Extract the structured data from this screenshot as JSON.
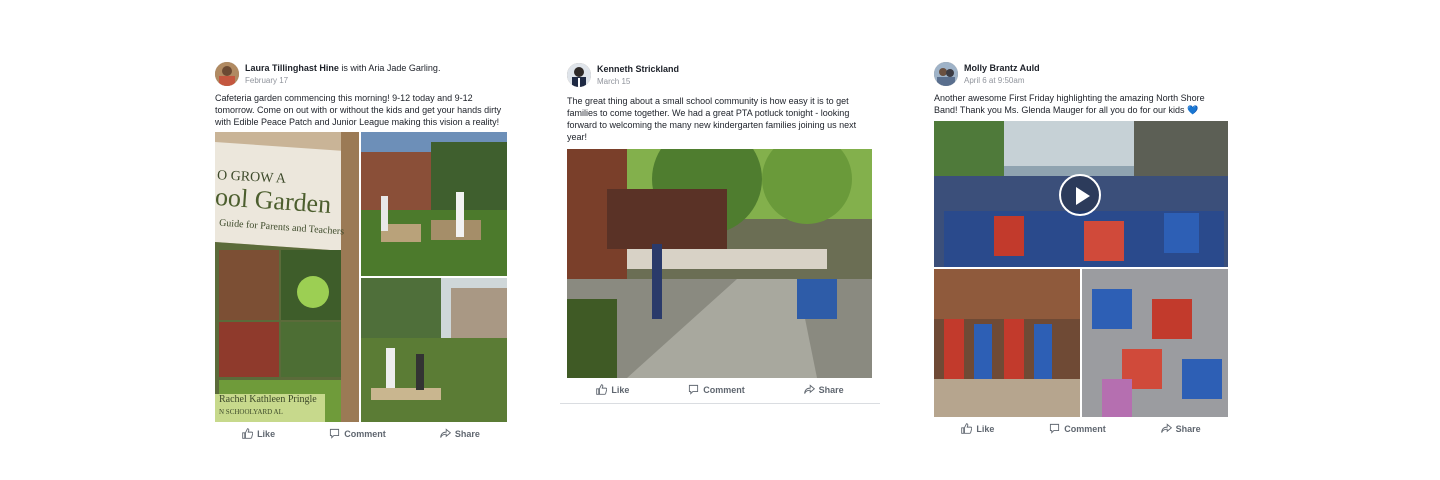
{
  "posts": [
    {
      "author": "Laura Tillinghast Hine",
      "with_text": "is with",
      "tagged": "Aria Jade Garling.",
      "date": "February 17",
      "text": "Cafeteria garden commencing this morning! 9-12 today and 9-12\ntomorrow. Come on out with or without the kids and get your hands dirty\nwith Edible Peace Patch and Junior League making this vision a reality!",
      "book_cover": {
        "title_line1": "O GROW A",
        "title_line2": "ool Garden",
        "subtitle": "Guide for Parents and Teachers",
        "author": "Rachel Kathleen Pringle",
        "footer": "N SCHOOLYARD AL"
      },
      "actions": {
        "like": "Like",
        "comment": "Comment",
        "share": "Share"
      }
    },
    {
      "author": "Kenneth Strickland",
      "date": "March 15",
      "text": "The great thing about a small school community is how easy it is to get\nfamilies to come together. We had a great PTA potluck tonight - looking\nforward to welcoming the many new kindergarten families joining us next\nyear!",
      "actions": {
        "like": "Like",
        "comment": "Comment",
        "share": "Share"
      }
    },
    {
      "author": "Molly Brantz Auld",
      "date": "April 6 at 9:50am",
      "text": "Another awesome First Friday highlighting the amazing North Shore\nBand! Thank you Ms. Glenda Mauger for all you do for our kids",
      "heart": "💙",
      "actions": {
        "like": "Like",
        "comment": "Comment",
        "share": "Share"
      }
    }
  ],
  "colors": {
    "text": "#1d2129",
    "muted": "#90949c",
    "action": "#606770",
    "divider": "#dadde1"
  }
}
